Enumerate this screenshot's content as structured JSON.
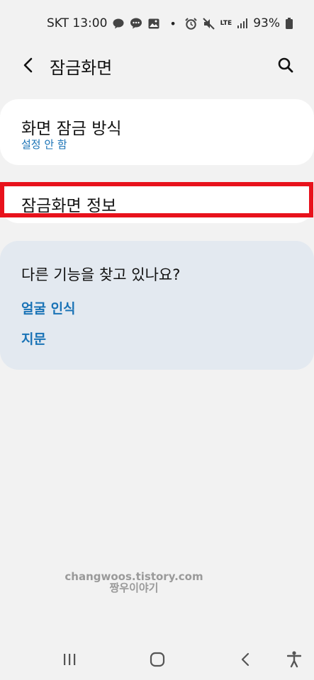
{
  "status_bar": {
    "carrier_time": "SKT 13:00",
    "battery": "93%",
    "icons_left": [
      "talk-icon",
      "message-icon",
      "gallery-icon",
      "dot"
    ],
    "icons_right": [
      "alarm-icon",
      "mute-icon",
      "lte-icon",
      "signal-icon",
      "battery-icon"
    ],
    "lte_label": "LTE"
  },
  "app_bar": {
    "title": "잠금화면",
    "back_icon": "back-chevron-icon",
    "search_icon": "search-icon"
  },
  "lock_method": {
    "title": "화면 잠금 방식",
    "value": "설정 안 함"
  },
  "lock_info": {
    "title": "잠금화면 정보",
    "highlight_color": "#e8121c"
  },
  "suggestions": {
    "heading": "다른 기능을 찾고 있나요?",
    "links": [
      "얼굴 인식",
      "지문"
    ]
  },
  "watermark": {
    "line1": "changwoos.tistory.com",
    "line2": "짱우이야기"
  },
  "nav_bar": {
    "buttons": [
      "recents-icon",
      "home-icon",
      "back-icon",
      "accessibility-icon"
    ]
  },
  "colors": {
    "background": "#f2f2f2",
    "card": "#ffffff",
    "suggest_card": "#e3e9f0",
    "accent": "#1a73b6"
  }
}
